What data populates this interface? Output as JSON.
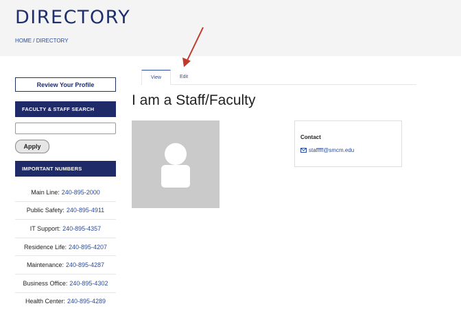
{
  "header": {
    "title": "DIRECTORY",
    "breadcrumb": {
      "home": "HOME",
      "sep": "/",
      "current": "DIRECTORY"
    }
  },
  "sidebar": {
    "review_button": "Review Your Profile",
    "search_heading": "FACULTY & STAFF SEARCH",
    "apply_button": "Apply",
    "numbers_heading": "IMPORTANT NUMBERS",
    "numbers": [
      {
        "label": "Main Line:",
        "phone": "240-895-2000"
      },
      {
        "label": "Public Safety:",
        "phone": "240-895-4911"
      },
      {
        "label": "IT Support:",
        "phone": "240-895-4357"
      },
      {
        "label": "Residence Life:",
        "phone": "240-895-4207"
      },
      {
        "label": "Maintenance:",
        "phone": "240-895-4287"
      },
      {
        "label": "Business Office:",
        "phone": "240-895-4302"
      },
      {
        "label": "Health Center:",
        "phone": "240-895-4289"
      }
    ]
  },
  "tabs": [
    {
      "label": "View",
      "active": true
    },
    {
      "label": "Edit",
      "active": false
    }
  ],
  "main": {
    "title": "I am a Staff/Faculty",
    "contact": {
      "label": "Contact",
      "email": "stafffff@smcm.edu"
    }
  },
  "colors": {
    "navy": "#1f2a68",
    "link": "#2a4a9c",
    "annotation_arrow": "#c0392b"
  }
}
